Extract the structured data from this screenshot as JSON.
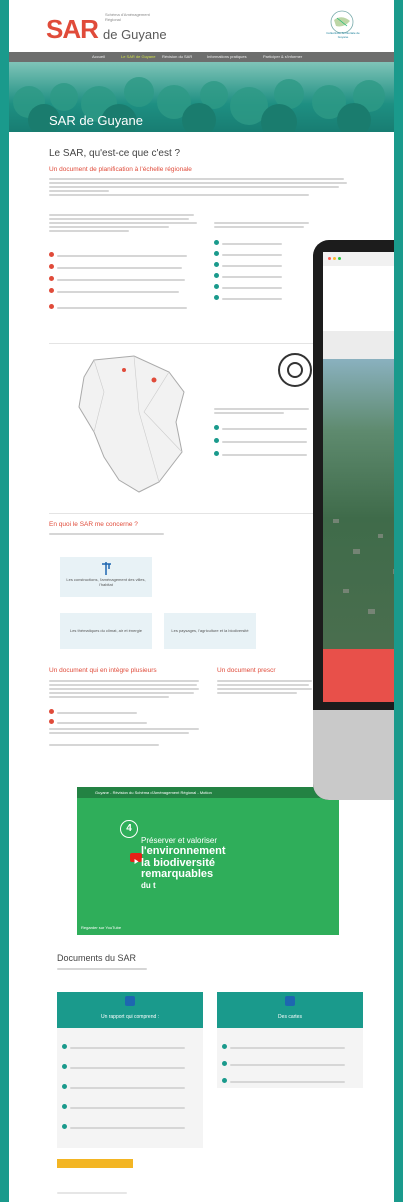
{
  "header": {
    "logo_main": "SAR",
    "logo_subtitle": "Schéma d'Aménagement Régional",
    "logo_region": "de Guyane",
    "ctg_label": "Collectivité Territoriale de Guyane"
  },
  "nav": {
    "items": [
      {
        "label": "Accueil"
      },
      {
        "label": "Le SAR de Guyane"
      },
      {
        "label": "Révision du SAR"
      },
      {
        "label": "Informations pratiques"
      },
      {
        "label": "Participer & s'informer"
      }
    ]
  },
  "hero": {
    "title": "SAR de Guyane"
  },
  "intro": {
    "title": "Le SAR, qu'est-ce que c'est ?",
    "subtitle": "Un document de planification à l'échelle régionale"
  },
  "concerne": {
    "title": "En quoi le SAR me concerne ?"
  },
  "cards": [
    {
      "label": "Les constructions, l'aménagement des villes, l'habitat"
    },
    {
      "label": "Les thématiques du climat, air et énergie"
    },
    {
      "label": "Les paysages, l'agriculture et la biodiversité"
    }
  ],
  "sections": {
    "integre": "Un document qui en intègre plusieurs",
    "prescr": "Un document prescr"
  },
  "video": {
    "header": "Guyane - Révision du Schéma d'Aménagement Régional - Motion",
    "badge": "4",
    "line1": "Préserver et valoriser",
    "line2": "l'environnement",
    "line3": "la biodiversité",
    "line4": "remarquables",
    "line5": "du t",
    "watch": "Regarder sur YouTube"
  },
  "documents": {
    "title": "Documents du SAR",
    "left_card": "Un rapport qui comprend :",
    "right_card": "Des cartes"
  },
  "colors": {
    "accent_red": "#e04b3a",
    "teal": "#1a9a8c",
    "yellow": "#f3b523"
  }
}
